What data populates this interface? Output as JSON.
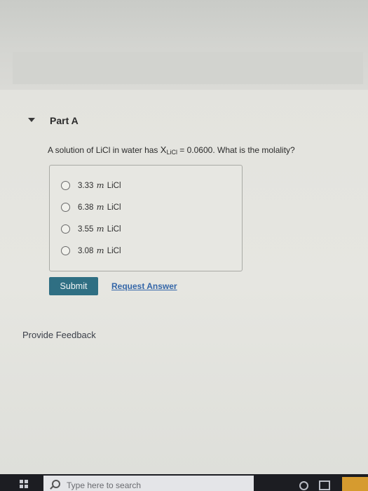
{
  "part": {
    "title": "Part A"
  },
  "question": {
    "text_before": "A solution of LiCl in water has ",
    "variable": "X",
    "variable_subscript": "LiCl",
    "text_after": " = 0.0600. What is the molality?"
  },
  "choices": [
    {
      "value": "3.33",
      "unit": "m",
      "compound": "LiCl"
    },
    {
      "value": "6.38",
      "unit": "m",
      "compound": "LiCl"
    },
    {
      "value": "3.55",
      "unit": "m",
      "compound": "LiCl"
    },
    {
      "value": "3.08",
      "unit": "m",
      "compound": "LiCl"
    }
  ],
  "actions": {
    "submit_label": "Submit",
    "request_label": "Request Answer"
  },
  "feedback": {
    "label": "Provide Feedback"
  },
  "taskbar": {
    "search_placeholder": "Type here to search",
    "icons": [
      "windows-start-icon",
      "search-icon",
      "cortana-icon",
      "task-view-icon",
      "app-icon"
    ]
  },
  "colors": {
    "submit_bg": "#2f6f83",
    "link": "#3466a8",
    "taskbar_bg": "#1c1d22"
  }
}
